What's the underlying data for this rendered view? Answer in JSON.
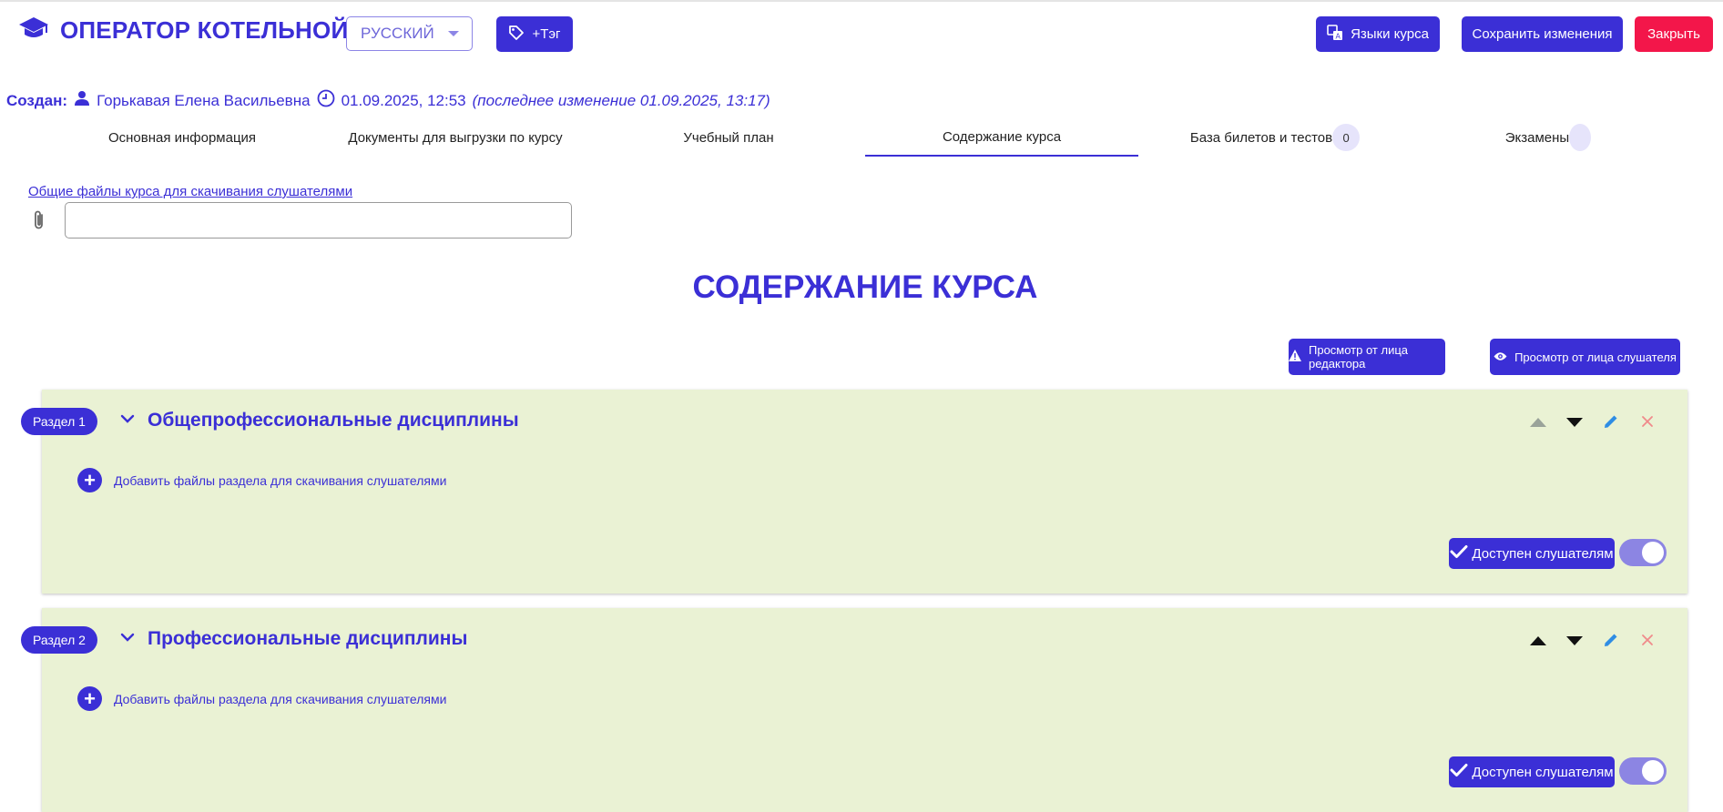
{
  "header": {
    "title": "ОПЕРАТОР КОТЕЛЬНОЙ",
    "language_select": {
      "selected": "РУССКИЙ"
    },
    "tag_button": "+Тэг",
    "languages_button": "Языки курса",
    "save_button": "Сохранить изменения",
    "close_button": "Закрыть"
  },
  "meta": {
    "created_label": "Создан:",
    "author": "Горькавая Елена Васильевна",
    "created_at": "01.09.2025, 12:53",
    "modified": "(последнее изменение 01.09.2025, 13:17)"
  },
  "tabs": [
    {
      "label": "Основная информация"
    },
    {
      "label": "Документы для выгрузки по курсу"
    },
    {
      "label": "Учебный план"
    },
    {
      "label": "Содержание курса",
      "active": true
    },
    {
      "label": "База билетов и тестов",
      "badge": "0"
    },
    {
      "label": "Экзамены",
      "badge": ""
    }
  ],
  "course_files": {
    "link_label": "Общие файлы курса для скачивания слушателями",
    "input_value": ""
  },
  "page_title": "СОДЕРЖАНИЕ КУРСА",
  "view_buttons": {
    "editor": "Просмотр от лица редактора",
    "student": "Просмотр от лица слушателя"
  },
  "sections": [
    {
      "pill": "Раздел 1",
      "title": "Общепрофессиональные дисциплины",
      "add_files": "Добавить файлы раздела для скачивания слушателями",
      "available_label": "Доступен слушателям",
      "available": true,
      "move_up_enabled": false
    },
    {
      "pill": "Раздел 2",
      "title": "Профессиональные дисциплины",
      "add_files": "Добавить файлы раздела для скачивания слушателями",
      "available_label": "Доступен слушателям",
      "available": true,
      "move_up_enabled": true
    }
  ],
  "colors": {
    "accent": "#3b2fd6",
    "danger": "#f3164a",
    "section_bg": "#eaf2d4",
    "toggle": "#8c85e3",
    "edit_icon": "#2f8de4",
    "delete_icon": "#f08a8a"
  },
  "icons": [
    "graduation-cap-icon",
    "tag-icon",
    "translate-icon",
    "person-icon",
    "clock-icon",
    "paperclip-icon",
    "warning-icon",
    "eye-icon",
    "chevron-down-icon",
    "arrow-up-icon",
    "arrow-down-icon",
    "pencil-icon",
    "close-icon",
    "plus-circle-icon",
    "check-icon"
  ]
}
